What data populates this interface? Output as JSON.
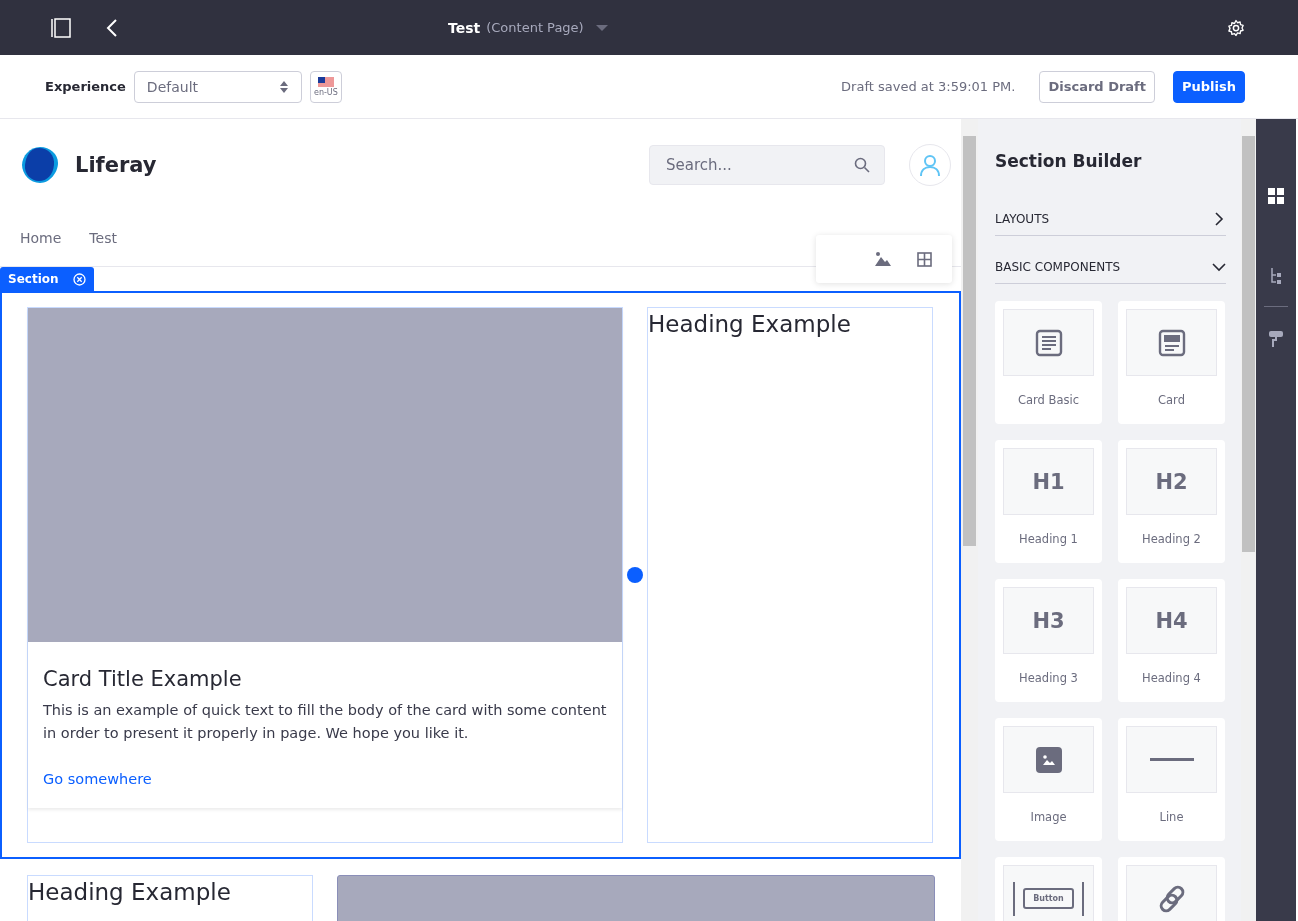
{
  "topbar": {
    "title": "Test",
    "subtitle": "(Content Page)"
  },
  "toolbar": {
    "experience_label": "Experience",
    "experience_value": "Default",
    "locale": "en-US",
    "draft_status": "Draft saved at 3:59:01 PM.",
    "buttons": [
      {
        "label": "Discard Draft",
        "kind": "secondary"
      },
      {
        "label": "Publish",
        "kind": "primary"
      }
    ]
  },
  "site": {
    "name": "Liferay",
    "search": {
      "placeholder": "Search..."
    },
    "nav": [
      "Home",
      "Test"
    ]
  },
  "section": {
    "tag": "Section",
    "card": {
      "title": "Card Title Example",
      "body": "This is an example of quick text to fill the body of the card with some content in order to present it properly in page. We hope you like it.",
      "link": "Go somewhere"
    },
    "heading": "Heading Example"
  },
  "next_section": {
    "heading": "Heading Example"
  },
  "sidebar": {
    "title": "Section Builder",
    "groups": [
      {
        "label": "LAYOUTS",
        "expanded": false
      },
      {
        "label": "BASIC COMPONENTS",
        "expanded": true
      }
    ],
    "components": [
      {
        "kind": "text-card",
        "label": "Card Basic"
      },
      {
        "kind": "image-card",
        "label": "Card"
      },
      {
        "kind": "heading",
        "glyph": "H1",
        "label": "Heading 1"
      },
      {
        "kind": "heading",
        "glyph": "H2",
        "label": "Heading 2"
      },
      {
        "kind": "heading",
        "glyph": "H3",
        "label": "Heading 3"
      },
      {
        "kind": "heading",
        "glyph": "H4",
        "label": "Heading 4"
      },
      {
        "kind": "image",
        "label": "Image"
      },
      {
        "kind": "line",
        "label": "Line"
      },
      {
        "kind": "button",
        "glyph": "Button"
      },
      {
        "kind": "link"
      }
    ]
  }
}
